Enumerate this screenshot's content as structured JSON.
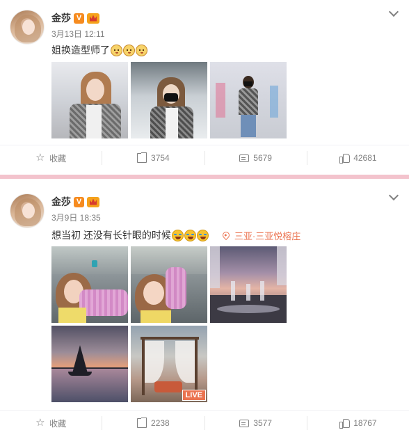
{
  "posts": [
    {
      "author": "金莎",
      "verified_badge": "V",
      "time": "3月13日 12:11",
      "text": "姐换造型师了",
      "emojis": [
        "dog-face-icon",
        "dog-face-icon",
        "dog-face-icon"
      ],
      "location": "",
      "photos": 3,
      "actions": {
        "favorite_label": "收藏",
        "repost_count": "3754",
        "comment_count": "5679",
        "like_count": "42681"
      }
    },
    {
      "author": "金莎",
      "verified_badge": "V",
      "time": "3月9日 18:35",
      "text": "想当初 还没有长针眼的时候",
      "emojis": [
        "laughing-tears-icon",
        "laughing-tears-icon",
        "laughing-tears-icon"
      ],
      "location": "三亚·三亚悦榕庄",
      "photos": 5,
      "live_badge": "LIVE",
      "actions": {
        "favorite_label": "收藏",
        "repost_count": "2238",
        "comment_count": "3577",
        "like_count": "18767"
      }
    }
  ],
  "colors": {
    "accent": "#eb7350",
    "divider": "#f3c3cd",
    "meta_text": "#808080"
  }
}
